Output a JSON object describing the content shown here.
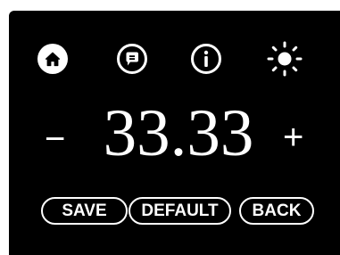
{
  "toolbar": {
    "icons": [
      "home-icon",
      "chat-icon",
      "info-icon",
      "brightness-icon"
    ]
  },
  "setting": {
    "value": "33.33",
    "decrement_label": "−",
    "increment_label": "+"
  },
  "actions": {
    "save_label": "SAVE",
    "default_label": "DEFAULT",
    "back_label": "BACK"
  },
  "colors": {
    "background": "#000000",
    "foreground": "#ffffff"
  }
}
